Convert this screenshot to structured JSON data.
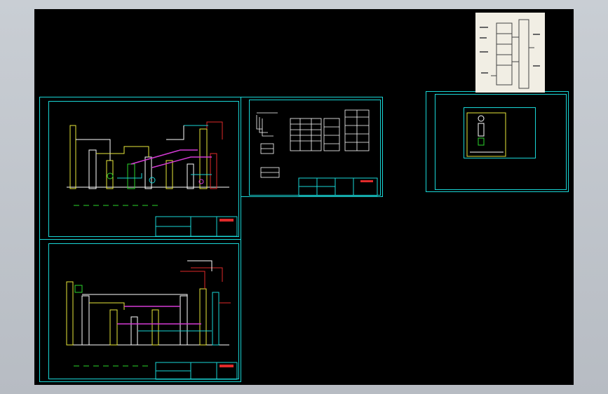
{
  "viewer": {
    "background": "#000000",
    "frame_color": "#bfc5cc",
    "line_colors": {
      "cyan": "#19d6d6",
      "yellow": "#e8e83a",
      "magenta": "#d43ad4",
      "red": "#e02a2a",
      "green": "#2bd62b",
      "white": "#ffffff"
    }
  },
  "drawings": [
    {
      "id": "process-flow-upper",
      "kind": "process-flow-diagram"
    },
    {
      "id": "process-flow-lower",
      "kind": "process-flow-diagram"
    },
    {
      "id": "equipment-table-sheet",
      "kind": "table-sheet"
    },
    {
      "id": "small-detail-sheet",
      "kind": "detail-sheet"
    },
    {
      "id": "reference-photo",
      "kind": "scanned-sketch"
    }
  ]
}
